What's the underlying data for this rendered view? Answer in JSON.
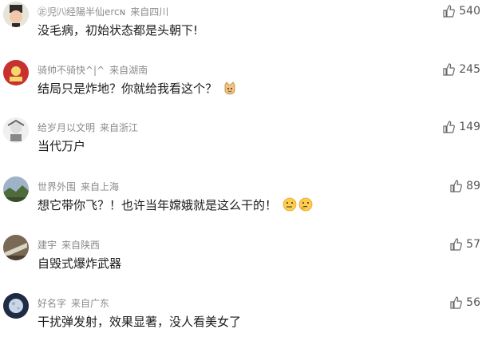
{
  "comments": [
    {
      "username": "㊣児㈧经陽半仙ercɴ",
      "location": "来自四川",
      "text": "没毛病，初始状态都是头朝下!",
      "likes": "540"
    },
    {
      "username": "骑帅不骑快^|^",
      "location": "来自湖南",
      "text": "结局只是炸地？你就给我看这个？",
      "likes": "245"
    },
    {
      "username": "给岁月以文明",
      "location": "来自浙江",
      "text": "当代万户",
      "likes": "149"
    },
    {
      "username": "世界外围",
      "location": "来自上海",
      "text": "想它带你飞？！也许当年嫦娥就是这么干的！",
      "likes": "89"
    },
    {
      "username": "建宇",
      "location": "来自陕西",
      "text": "自毁式爆炸武器",
      "likes": "57"
    },
    {
      "username": "好名字",
      "location": "来自广东",
      "text": "干扰弹发射，效果显著，没人看美女了",
      "likes": "56"
    }
  ],
  "icons": {
    "like": "thumbs-up-icon"
  }
}
